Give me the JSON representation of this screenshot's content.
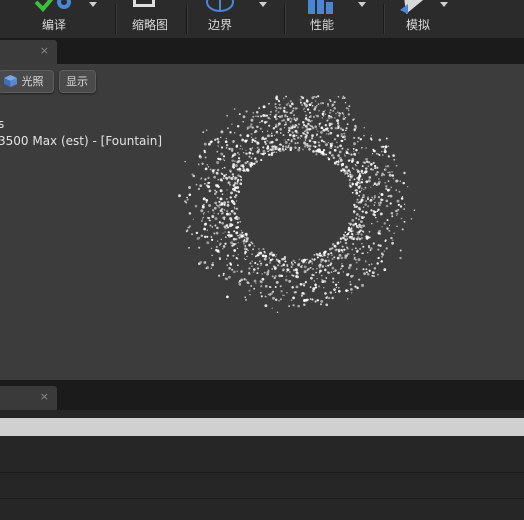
{
  "toolbar": {
    "items": [
      {
        "label": "编译",
        "icon": "compile-check-icon"
      },
      {
        "label": "缩略图",
        "icon": "thumbnail-icon"
      },
      {
        "label": "边界",
        "icon": "bounds-sphere-icon"
      },
      {
        "label": "性能",
        "icon": "performance-bars-icon"
      },
      {
        "label": "模拟",
        "icon": "simulate-play-icon"
      }
    ]
  },
  "viewport": {
    "tab_close": "×",
    "lighting_label": "光照",
    "show_label": "显示",
    "overlay_line1": "s",
    "overlay_line2": "3500 Max (est) - [Fountain]"
  },
  "lower_panel": {
    "tab_close": "×",
    "progress_fraction": 1.0
  },
  "colors": {
    "toolbar_bg": "#2b2b2b",
    "viewport_bg": "#3c3c3c",
    "particle": "#ffffff",
    "compile_green": "#3cbf3c",
    "bounds_blue": "#4a86d6"
  }
}
